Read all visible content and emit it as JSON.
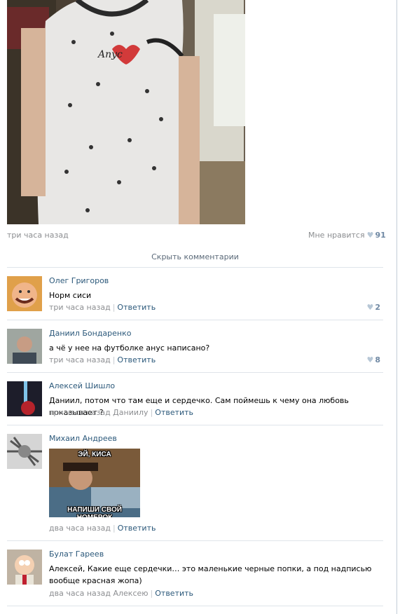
{
  "post": {
    "time": "три часа назад",
    "like_label": "Мне нравится",
    "like_count": "91",
    "hide_comments": "Скрыть комментарии"
  },
  "comments": [
    {
      "author": "Олег Григоров",
      "text": "Норм сиси",
      "time": "три часа назад",
      "reply": "Ответить",
      "likes": "2",
      "avatar": "smiling-man-avatar"
    },
    {
      "author": "Даниил Бондаренко",
      "text": "а чё у нее на футболке анус написано?",
      "time": "три часа назад",
      "reply": "Ответить",
      "likes": "8",
      "avatar": "selfie-avatar"
    },
    {
      "author": "Алексей Шишло",
      "text": "Даниил, потом что там еще и сердечко. Сам поймешь к чему она любовь показывает ?",
      "time": "три часа назад Даниилу",
      "reply": "Ответить",
      "avatar": "dark-avatar"
    },
    {
      "author": "Михаил Андреев",
      "text": "",
      "time": "два часа назад",
      "reply": "Ответить",
      "avatar": "tiger-avatar",
      "attachment": {
        "top_caption": "ЭЙ, КИСА",
        "bottom_caption": "НАПИШИ СВОЙ НОМЕРОК"
      }
    },
    {
      "author": "Булат Гареев",
      "text": "Алексей, Какие еще сердечки… это маленькие черные попки, а под надписью вообще красная жопа)",
      "time": "два часа назад Алексею",
      "reply": "Ответить",
      "avatar": "cartoon-avatar"
    }
  ],
  "shirt_print": "Anyc",
  "colors": {
    "link": "#2b587a",
    "meta": "#8c8e91",
    "separator": "#dfe4ea",
    "heart": "#b7c7d6"
  }
}
